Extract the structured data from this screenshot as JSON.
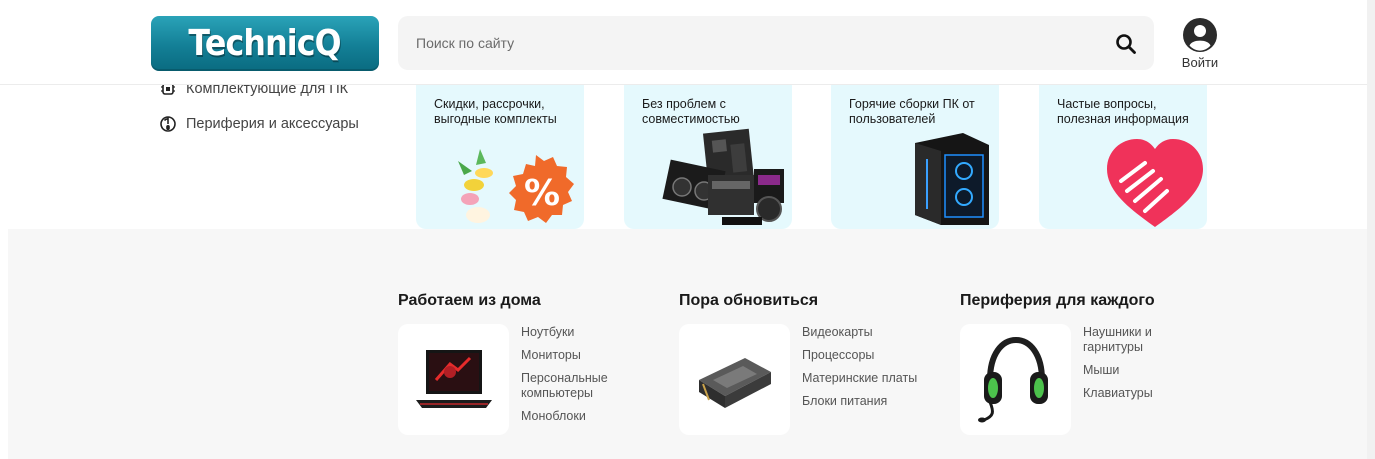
{
  "header": {
    "logo_text": "TechnicQ",
    "search_placeholder": "Поиск по сайту",
    "login_label": "Войти"
  },
  "sidebar": {
    "items": [
      {
        "label": "Комплектующие для ПК",
        "icon": "chip-icon"
      },
      {
        "label": "Периферия и аксессуары",
        "icon": "mouse-icon"
      }
    ]
  },
  "promos": [
    {
      "text": "Скидки, рассрочки, выгодные комплекты",
      "icon": "percent-flowers-icon"
    },
    {
      "text": "Без проблем с совместимостью",
      "icon": "pc-components-icon"
    },
    {
      "text": "Горячие сборки ПК от пользователей",
      "icon": "pc-case-icon"
    },
    {
      "text": "Частые вопросы, полезная информация",
      "icon": "heart-hand-icon"
    }
  ],
  "categories": [
    {
      "title": "Работаем из дома",
      "icon": "laptop-icon",
      "links": [
        "Ноутбуки",
        "Мониторы",
        "Персональные компьютеры",
        "Моноблоки"
      ]
    },
    {
      "title": "Пора обновиться",
      "icon": "graphics-card-icon",
      "links": [
        "Видеокарты",
        "Процессоры",
        "Материнские платы",
        "Блоки питания"
      ]
    },
    {
      "title": "Периферия для каждого",
      "icon": "headset-icon",
      "links": [
        "Наушники и гарнитуры",
        "Мыши",
        "Клавиатуры"
      ]
    }
  ],
  "colors": {
    "logo": "#137f96",
    "promo_bg": "#e5f9fd",
    "accent_orange": "#f06a2a",
    "accent_pink": "#f0325a",
    "lower_bg": "#f7f7f7"
  }
}
